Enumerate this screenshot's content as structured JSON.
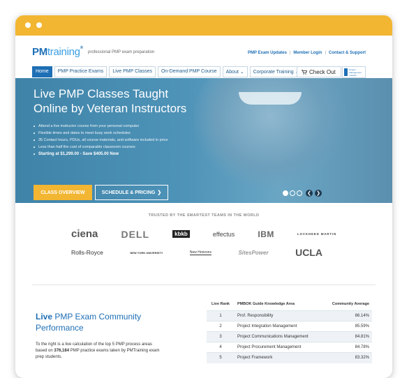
{
  "brand": {
    "pm": "PM",
    "training": "training",
    "reg": "®",
    "tagline": "professional PMP exam preparation"
  },
  "top_links": [
    "PMP Exam Updates",
    "Member Login",
    "Contact & Support"
  ],
  "nav": {
    "items": [
      "Home",
      "PMP Practice Exams",
      "Live PMP Classes",
      "On-Demand PMP Course",
      "About ⌄",
      "Corporate Training ⌄"
    ],
    "checkout": "Check Out",
    "pmi_text": "Project Management Institute"
  },
  "hero": {
    "title_line1": "Live PMP Classes Taught",
    "title_line2": "Online by Veteran Instructors",
    "bullets": [
      "Attend a live instructor course from your personal computer",
      "Flexible times and dates to meet busy work schedules",
      "35 Contact hours, PDUs, all course materials, and software included in price",
      "Less than half the cost of comparable classroom courses"
    ],
    "price": "Starting at $1,299.00 - Save $405.00 Now",
    "btn_overview": "CLASS OVERVIEW",
    "btn_schedule": "SCHEDULE & PRICING",
    "btn_schedule_arrow": "❯",
    "arrow_left": "❮",
    "arrow_right": "❯"
  },
  "trusted": {
    "heading": "TRUSTED BY THE SMARTEST TEAMS IN THE WORLD",
    "row1": [
      "ciena",
      "DELL",
      "kbkb",
      "effectus",
      "IBM",
      "LOCKHEED MARTIN"
    ],
    "row2": [
      "Rolls-Royce",
      "NEW YORK UNIVERSITY",
      "New Horizons",
      "SitesPower",
      "UCLA"
    ]
  },
  "community": {
    "title_live": "Live",
    "title_rest": " PMP Exam Community Performance",
    "desc_pre": "To the right is a live calculation of the top 5 PMP process areas based on ",
    "desc_count": "376,184",
    "desc_post": " PMP practice exams taken by PMTraining exam prep students."
  },
  "rank_table": {
    "headers": [
      "Live Rank",
      "PMBOK Guide Knowledge Area",
      "Community Average"
    ],
    "rows": [
      [
        "1",
        "Prof. Responsibility",
        "86.14%"
      ],
      [
        "2",
        "Project Integration Management",
        "85.59%"
      ],
      [
        "3",
        "Project Communications Management",
        "84.81%"
      ],
      [
        "4",
        "Project Procurement Management",
        "84.78%"
      ],
      [
        "5",
        "Project Framework",
        "83.32%"
      ]
    ]
  },
  "colors": {
    "chrome": "#f2b632",
    "brand_blue": "#1e6fb5",
    "hero_bg": "#4e93b8",
    "accent_yellow": "#f2b632"
  }
}
